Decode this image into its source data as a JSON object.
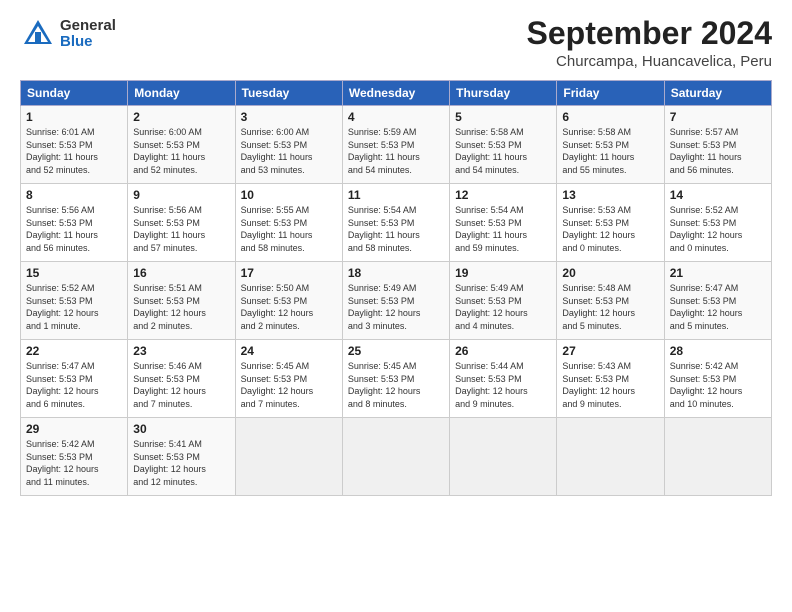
{
  "logo": {
    "general": "General",
    "blue": "Blue"
  },
  "title": "September 2024",
  "location": "Churcampa, Huancavelica, Peru",
  "weekdays": [
    "Sunday",
    "Monday",
    "Tuesday",
    "Wednesday",
    "Thursday",
    "Friday",
    "Saturday"
  ],
  "weeks": [
    [
      {
        "day": "1",
        "info": "Sunrise: 6:01 AM\nSunset: 5:53 PM\nDaylight: 11 hours\nand 52 minutes."
      },
      {
        "day": "2",
        "info": "Sunrise: 6:00 AM\nSunset: 5:53 PM\nDaylight: 11 hours\nand 52 minutes."
      },
      {
        "day": "3",
        "info": "Sunrise: 6:00 AM\nSunset: 5:53 PM\nDaylight: 11 hours\nand 53 minutes."
      },
      {
        "day": "4",
        "info": "Sunrise: 5:59 AM\nSunset: 5:53 PM\nDaylight: 11 hours\nand 54 minutes."
      },
      {
        "day": "5",
        "info": "Sunrise: 5:58 AM\nSunset: 5:53 PM\nDaylight: 11 hours\nand 54 minutes."
      },
      {
        "day": "6",
        "info": "Sunrise: 5:58 AM\nSunset: 5:53 PM\nDaylight: 11 hours\nand 55 minutes."
      },
      {
        "day": "7",
        "info": "Sunrise: 5:57 AM\nSunset: 5:53 PM\nDaylight: 11 hours\nand 56 minutes."
      }
    ],
    [
      {
        "day": "8",
        "info": "Sunrise: 5:56 AM\nSunset: 5:53 PM\nDaylight: 11 hours\nand 56 minutes."
      },
      {
        "day": "9",
        "info": "Sunrise: 5:56 AM\nSunset: 5:53 PM\nDaylight: 11 hours\nand 57 minutes."
      },
      {
        "day": "10",
        "info": "Sunrise: 5:55 AM\nSunset: 5:53 PM\nDaylight: 11 hours\nand 58 minutes."
      },
      {
        "day": "11",
        "info": "Sunrise: 5:54 AM\nSunset: 5:53 PM\nDaylight: 11 hours\nand 58 minutes."
      },
      {
        "day": "12",
        "info": "Sunrise: 5:54 AM\nSunset: 5:53 PM\nDaylight: 11 hours\nand 59 minutes."
      },
      {
        "day": "13",
        "info": "Sunrise: 5:53 AM\nSunset: 5:53 PM\nDaylight: 12 hours\nand 0 minutes."
      },
      {
        "day": "14",
        "info": "Sunrise: 5:52 AM\nSunset: 5:53 PM\nDaylight: 12 hours\nand 0 minutes."
      }
    ],
    [
      {
        "day": "15",
        "info": "Sunrise: 5:52 AM\nSunset: 5:53 PM\nDaylight: 12 hours\nand 1 minute."
      },
      {
        "day": "16",
        "info": "Sunrise: 5:51 AM\nSunset: 5:53 PM\nDaylight: 12 hours\nand 2 minutes."
      },
      {
        "day": "17",
        "info": "Sunrise: 5:50 AM\nSunset: 5:53 PM\nDaylight: 12 hours\nand 2 minutes."
      },
      {
        "day": "18",
        "info": "Sunrise: 5:49 AM\nSunset: 5:53 PM\nDaylight: 12 hours\nand 3 minutes."
      },
      {
        "day": "19",
        "info": "Sunrise: 5:49 AM\nSunset: 5:53 PM\nDaylight: 12 hours\nand 4 minutes."
      },
      {
        "day": "20",
        "info": "Sunrise: 5:48 AM\nSunset: 5:53 PM\nDaylight: 12 hours\nand 5 minutes."
      },
      {
        "day": "21",
        "info": "Sunrise: 5:47 AM\nSunset: 5:53 PM\nDaylight: 12 hours\nand 5 minutes."
      }
    ],
    [
      {
        "day": "22",
        "info": "Sunrise: 5:47 AM\nSunset: 5:53 PM\nDaylight: 12 hours\nand 6 minutes."
      },
      {
        "day": "23",
        "info": "Sunrise: 5:46 AM\nSunset: 5:53 PM\nDaylight: 12 hours\nand 7 minutes."
      },
      {
        "day": "24",
        "info": "Sunrise: 5:45 AM\nSunset: 5:53 PM\nDaylight: 12 hours\nand 7 minutes."
      },
      {
        "day": "25",
        "info": "Sunrise: 5:45 AM\nSunset: 5:53 PM\nDaylight: 12 hours\nand 8 minutes."
      },
      {
        "day": "26",
        "info": "Sunrise: 5:44 AM\nSunset: 5:53 PM\nDaylight: 12 hours\nand 9 minutes."
      },
      {
        "day": "27",
        "info": "Sunrise: 5:43 AM\nSunset: 5:53 PM\nDaylight: 12 hours\nand 9 minutes."
      },
      {
        "day": "28",
        "info": "Sunrise: 5:42 AM\nSunset: 5:53 PM\nDaylight: 12 hours\nand 10 minutes."
      }
    ],
    [
      {
        "day": "29",
        "info": "Sunrise: 5:42 AM\nSunset: 5:53 PM\nDaylight: 12 hours\nand 11 minutes."
      },
      {
        "day": "30",
        "info": "Sunrise: 5:41 AM\nSunset: 5:53 PM\nDaylight: 12 hours\nand 12 minutes."
      },
      null,
      null,
      null,
      null,
      null
    ]
  ]
}
